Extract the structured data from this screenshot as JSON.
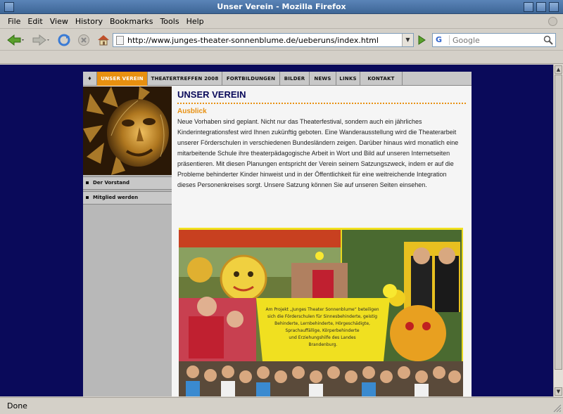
{
  "window": {
    "title": "Unser Verein - Mozilla Firefox"
  },
  "menu": [
    "File",
    "Edit",
    "View",
    "History",
    "Bookmarks",
    "Tools",
    "Help"
  ],
  "toolbar": {
    "url": "http://www.junges-theater-sonnenblume.de/ueberuns/index.html",
    "search_placeholder": "Google",
    "search_engine_icon": "G"
  },
  "site": {
    "nav": [
      {
        "label": "♦",
        "icon": "home-diamond-icon"
      },
      {
        "label": "UNSER VEREIN",
        "active": true
      },
      {
        "label": "THEATERTREFFEN 2008"
      },
      {
        "label": "FORTBILDUNGEN"
      },
      {
        "label": "BILDER"
      },
      {
        "label": "NEWS"
      },
      {
        "label": "LINKS"
      },
      {
        "label": "KONTAKT"
      }
    ],
    "sidebar": [
      {
        "label": "Der Vorstand"
      },
      {
        "label": "Mitglied werden"
      }
    ],
    "heading": "UNSER VEREIN",
    "subheading": "Ausblick",
    "paragraph": "Neue Vorhaben sind geplant. Nicht nur das Theaterfestival, sondern auch ein jährliches Kinderintegrationsfest wird Ihnen zukünftig geboten. Eine Wanderausstellung wird die Theaterarbeit unserer Förderschulen in verschiedenen Bundesländern zeigen. Darüber hinaus wird monatlich eine mitarbeitende Schule ihre theaterpädagogische Arbeit in Wort und Bild auf unseren Internetseiten präsentieren. Mit diesen Planungen entspricht der Verein seinem Satzungszweck, indem er auf die Probleme behinderter Kinder hinweist und in der Öffentlichkeit für eine weitreichende Integration dieses Personenkreises sorgt. Unsere Satzung können Sie auf unseren Seiten einsehen.",
    "photo_caption": "Am Projekt „Junges Theater Sonnenblume“ beteiligen sich die Förderschulen für Sinnesbehinderte, geistig Behinderte, Lernbehinderte, Hörgeschädigte, Sprachauffällige, Körperbehinderte und Erziehungshilfe des Landes Brandenburg."
  },
  "status": {
    "text": "Done"
  },
  "colors": {
    "accent": "#e89010",
    "page_bg": "#0a0a5a",
    "heading": "#0a0a5a"
  }
}
